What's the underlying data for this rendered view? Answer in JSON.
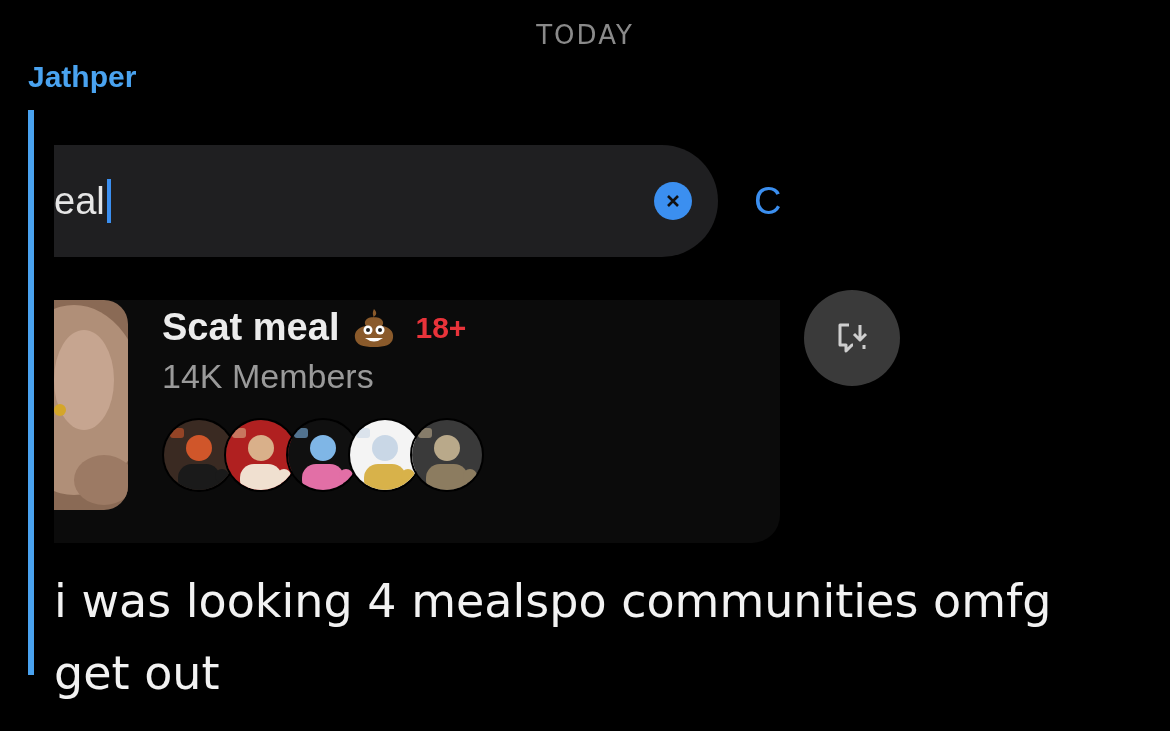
{
  "date_divider": "TODAY",
  "message": {
    "sender": "Jathper",
    "shared_screenshot": {
      "search": {
        "value": "eal",
        "focused": true
      },
      "cancel_label": "C",
      "community": {
        "name": "Scat meal",
        "badge": "18+",
        "members": "14K Members"
      }
    },
    "text": "i was looking 4 mealspo communities omfg get out"
  }
}
